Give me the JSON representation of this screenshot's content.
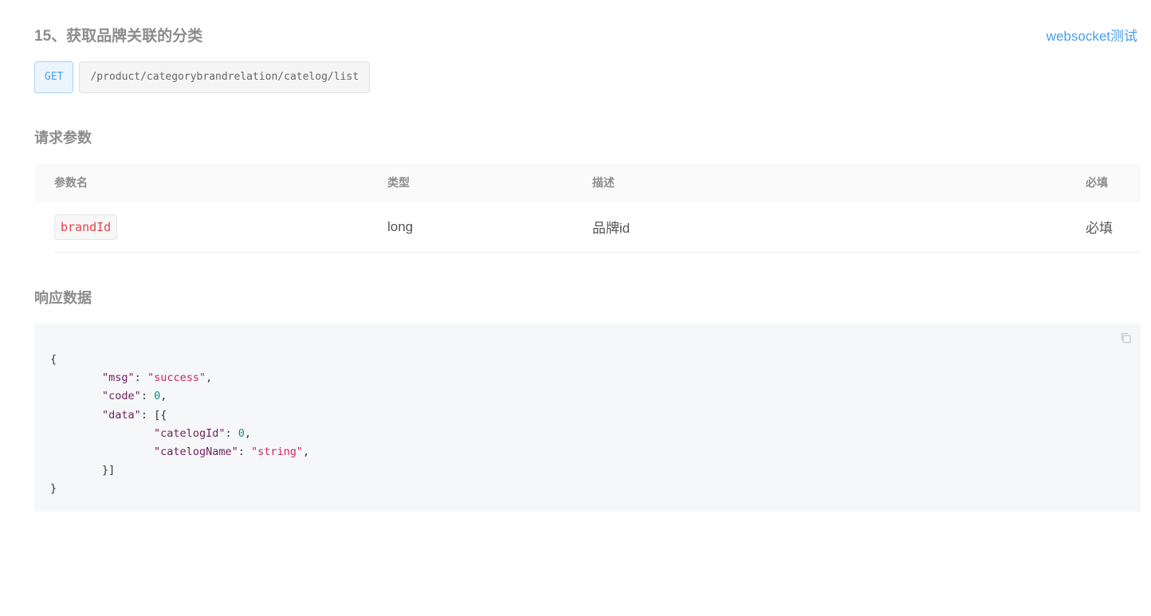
{
  "api": {
    "title": "15、获取品牌关联的分类",
    "method": "GET",
    "path": "/product/categorybrandrelation/catelog/list",
    "ws_link": "websocket测试"
  },
  "params_section": {
    "title": "请求参数",
    "columns": [
      "参数名",
      "类型",
      "描述",
      "必填"
    ],
    "rows": [
      {
        "name": "brandId",
        "type": "long",
        "desc": "品牌id",
        "required": "必填"
      }
    ]
  },
  "response_section": {
    "title": "响应数据",
    "copy_icon": "copy-icon",
    "code": {
      "open_brace": "{",
      "close_brace": "}",
      "msg_key": "\"msg\"",
      "msg_val": "\"success\"",
      "code_key": "\"code\"",
      "code_val": "0",
      "data_key": "\"data\"",
      "data_open": "[{",
      "catelogId_key": "\"catelogId\"",
      "catelogId_val": "0",
      "catelogName_key": "\"catelogName\"",
      "catelogName_val": "\"string\"",
      "data_close": "}]"
    }
  },
  "colors": {
    "link": "#4a9ee8",
    "method_bg": "#ecf5ff",
    "param_code": "#e0454b",
    "code_bg": "#f6f7f8"
  }
}
